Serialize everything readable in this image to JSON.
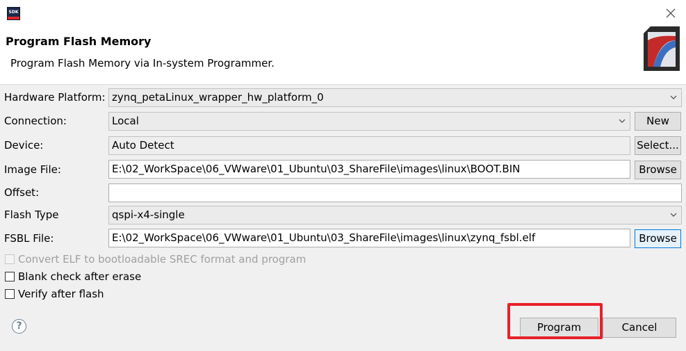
{
  "window": {
    "app_icon_text": "SDK"
  },
  "header": {
    "title": "Program Flash Memory",
    "subtitle": "Program Flash Memory via In-system Programmer."
  },
  "form": {
    "hardware_platform": {
      "label": "Hardware Platform:",
      "value": "zynq_petaLinux_wrapper_hw_platform_0"
    },
    "connection": {
      "label": "Connection:",
      "value": "Local",
      "button": "New"
    },
    "device": {
      "label": "Device:",
      "value": "Auto Detect",
      "button": "Select..."
    },
    "image_file": {
      "label": "Image File:",
      "value": "E:\\02_WorkSpace\\06_VWware\\01_Ubuntu\\03_ShareFile\\images\\linux\\BOOT.BIN",
      "button": "Browse"
    },
    "offset": {
      "label": "Offset:",
      "value": ""
    },
    "flash_type": {
      "label": "Flash Type",
      "value": "qspi-x4-single"
    },
    "fsbl_file": {
      "label": "FSBL File:",
      "value": "E:\\02_WorkSpace\\06_VWware\\01_Ubuntu\\03_ShareFile\\images\\linux\\zynq_fsbl.elf",
      "button": "Browse"
    }
  },
  "options": {
    "convert_elf": {
      "label": "Convert ELF to bootloadable SREC format and program",
      "checked": false,
      "enabled": false
    },
    "blank_check": {
      "label": "Blank check after erase",
      "checked": false
    },
    "verify": {
      "label": "Verify after flash",
      "checked": false
    }
  },
  "footer": {
    "help_icon_text": "?",
    "program_label": "Program",
    "cancel_label": "Cancel"
  },
  "colors": {
    "highlight": "#e8202a",
    "focus_border": "#0078d7"
  },
  "icons": [
    "sdk-app-icon",
    "close-icon",
    "flash-banner-icon",
    "chevron-down-icon",
    "help-icon"
  ]
}
